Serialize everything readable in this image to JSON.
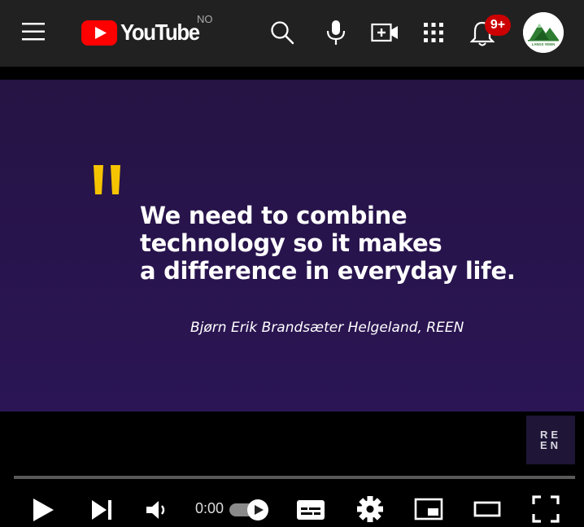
{
  "header": {
    "logo_text": "YouTube",
    "region_code": "NO",
    "notification_count": "9+",
    "icons": [
      "menu-icon",
      "search-icon",
      "mic-icon",
      "create-icon",
      "apps-icon",
      "bell-icon"
    ],
    "brand_color": "#ff0000"
  },
  "avatar": {
    "label": "LANGS VEIEN"
  },
  "video": {
    "quote_lines": [
      "We need to combine",
      "technology so it makes",
      "a difference in everyday life."
    ],
    "attribution": "Bjørn Erik Brandsæter Helgeland, REEN",
    "watermark_lines": [
      "RE",
      "EN"
    ],
    "quote_color": "#f5c400",
    "background_color": "#261446"
  },
  "player": {
    "time": "0:00",
    "progress": 0,
    "autoplay": true,
    "icons": [
      "play-icon",
      "next-icon",
      "volume-icon",
      "autoplay-toggle",
      "subtitles-icon",
      "settings-icon",
      "miniplayer-icon",
      "theater-icon",
      "fullscreen-icon"
    ]
  }
}
